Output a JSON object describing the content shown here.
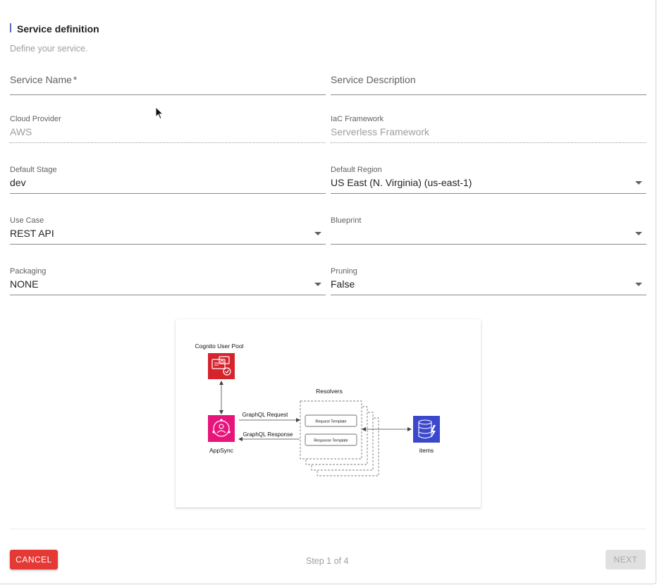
{
  "header": {
    "title": "Service definition",
    "subtitle": "Define your service."
  },
  "form": {
    "service_name": {
      "label": "Service Name",
      "required_mark": "*",
      "value": ""
    },
    "service_description": {
      "label": "Service Description",
      "value": ""
    },
    "cloud_provider": {
      "label": "Cloud Provider",
      "value": "AWS"
    },
    "iac_framework": {
      "label": "IaC Framework",
      "value": "Serverless Framework"
    },
    "default_stage": {
      "label": "Default Stage",
      "value": "dev"
    },
    "default_region": {
      "label": "Default Region",
      "value": "US East (N. Virginia) (us-east-1)"
    },
    "use_case": {
      "label": "Use Case",
      "value": "REST API"
    },
    "blueprint": {
      "label": "Blueprint",
      "value": ""
    },
    "packaging": {
      "label": "Packaging",
      "value": "NONE"
    },
    "pruning": {
      "label": "Pruning",
      "value": "False"
    }
  },
  "diagram": {
    "cognito_label": "Cognito User Pool",
    "appsync_label": "AppSync",
    "resolvers_label": "Resolvers",
    "request_template": "Request Template",
    "response_template": "Response Template",
    "graphql_request": "GraphQL Request",
    "graphql_response": "GraphQL Response",
    "items_label": "items",
    "colors": {
      "cognito": "#d6242d",
      "appsync": "#e7157b",
      "dynamodb": "#3b48cc"
    }
  },
  "footer": {
    "cancel_label": "CANCEL",
    "step_text": "Step 1 of 4",
    "next_label": "NEXT"
  }
}
